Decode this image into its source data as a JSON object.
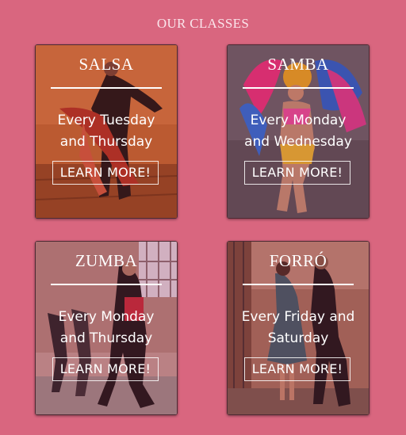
{
  "page": {
    "heading": "OUR CLASSES"
  },
  "classes": [
    {
      "title": "SALSA",
      "schedule_line1": "Every Tuesday",
      "schedule_line2": "and Thursday",
      "button": "LEARN MORE!"
    },
    {
      "title": "SAMBA",
      "schedule_line1": "Every Monday",
      "schedule_line2": "and Wednesday",
      "button": "LEARN MORE!"
    },
    {
      "title": "ZUMBA",
      "schedule_line1": "Every Monday",
      "schedule_line2": "and Thursday",
      "button": "LEARN MORE!"
    },
    {
      "title": "FORRÓ",
      "schedule_line1": "Every Friday and",
      "schedule_line2": "Saturday",
      "button": "LEARN MORE!"
    }
  ],
  "colors": {
    "background": "#d9667f",
    "overlay": "#8a2740"
  }
}
